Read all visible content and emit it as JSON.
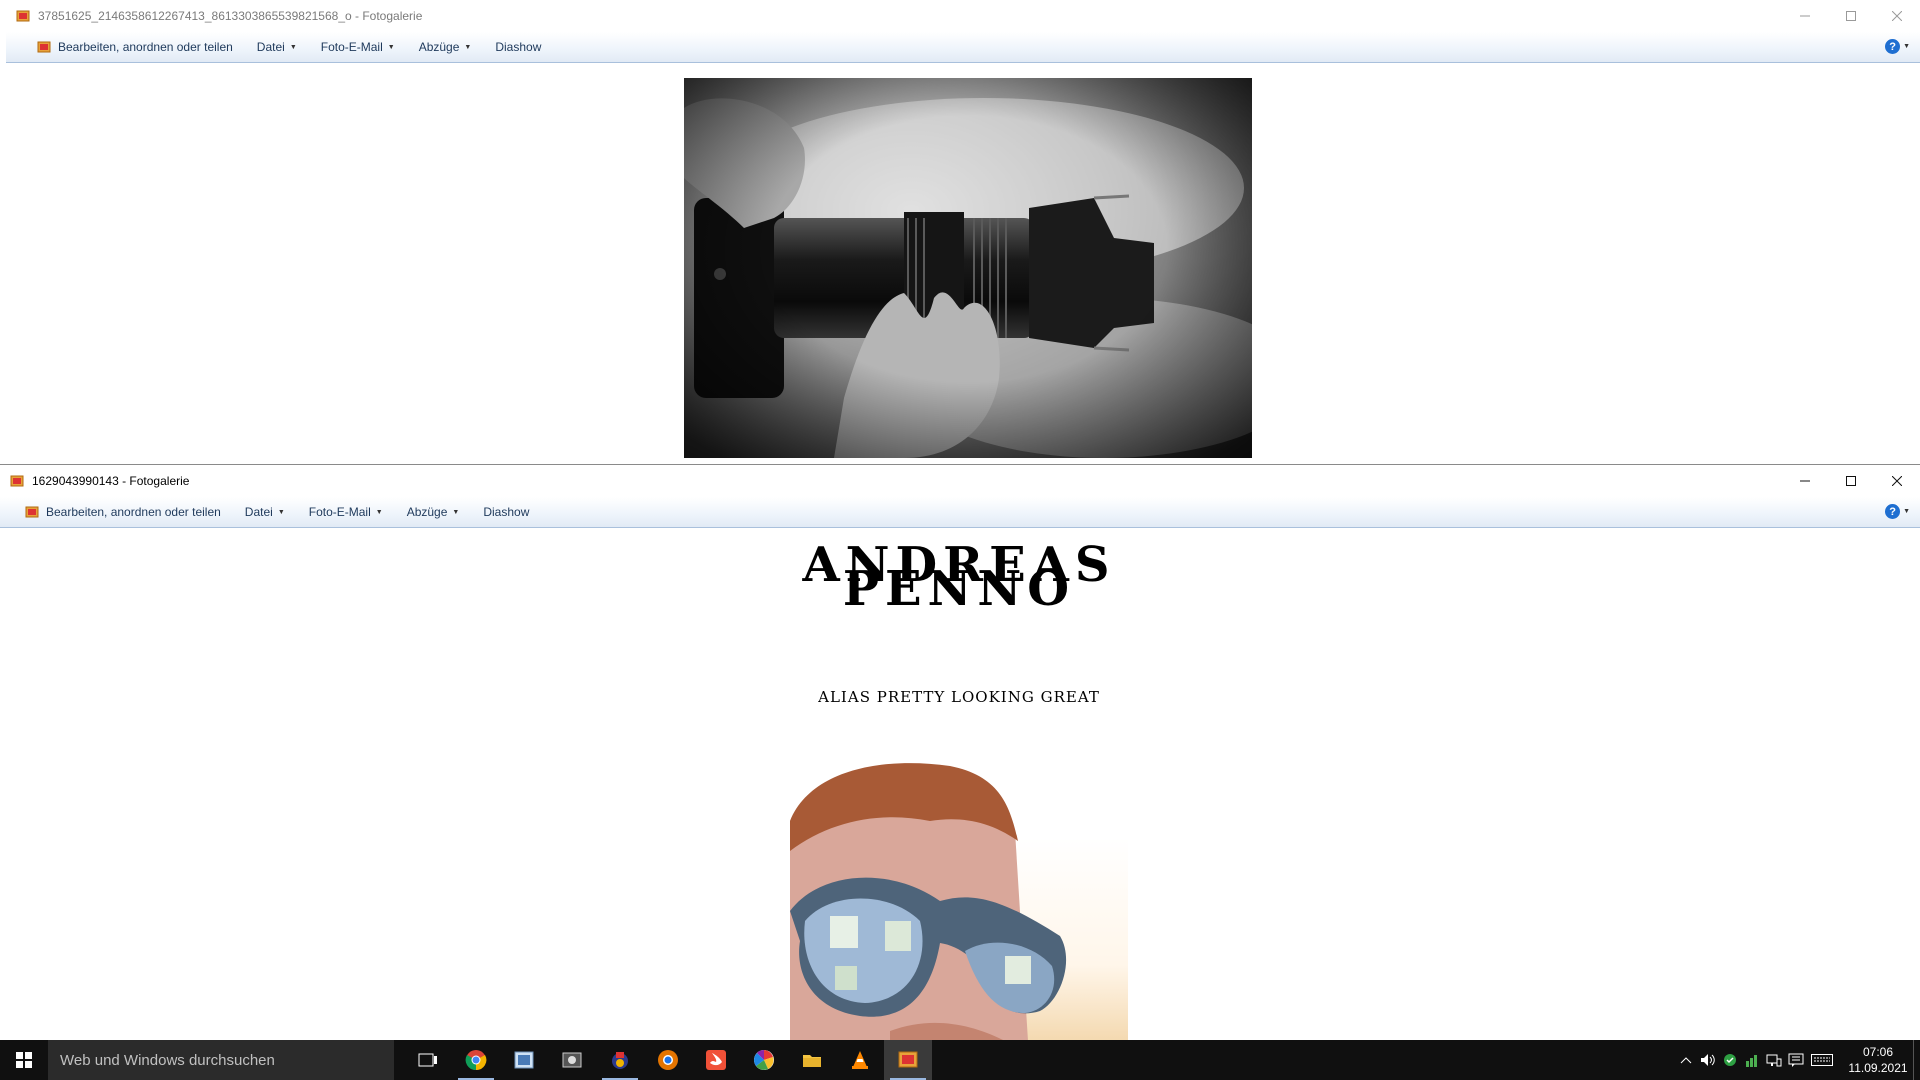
{
  "top_window": {
    "title": "37851625_2146358612267413_8613303865539821568_o - Fotogalerie",
    "commands": {
      "edit": "Bearbeiten, anordnen oder teilen",
      "file": "Datei",
      "email": "Foto-E-Mail",
      "prints": "Abzüge",
      "slideshow": "Diashow"
    }
  },
  "bottom_window": {
    "title": "1629043990143 - Fotogalerie",
    "commands": {
      "edit": "Bearbeiten, anordnen oder teilen",
      "file": "Datei",
      "email": "Foto-E-Mail",
      "prints": "Abzüge",
      "slideshow": "Diashow"
    },
    "poster": {
      "name_line1": "ANDREAS",
      "name_line2": "PENNO",
      "alias": "ALIAS PRETTY LOOKING GREAT"
    }
  },
  "help_icon": "?",
  "taskbar": {
    "search_placeholder": "Web und Windows durchsuchen",
    "apps": [
      "task-view",
      "chrome",
      "photo-viewer",
      "video-editor",
      "paint",
      "chrome-alt",
      "swift",
      "picasa",
      "file-explorer",
      "vlc",
      "photo-gallery"
    ],
    "clock_time": "07:06",
    "clock_date": "11.09.2021"
  },
  "colors": {
    "accent": "#1f6fd1",
    "taskbar": "#101010",
    "commandbar_text": "#1e395b"
  }
}
